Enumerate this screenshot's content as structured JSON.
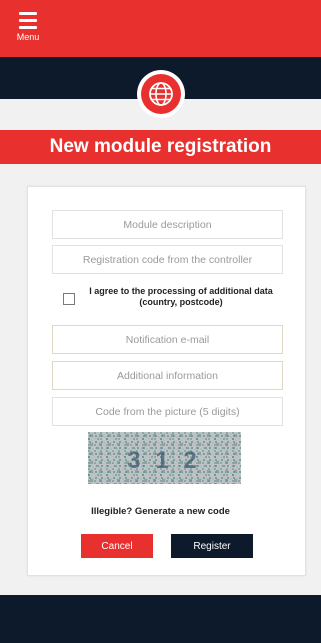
{
  "menu": {
    "label": "Menu"
  },
  "page": {
    "title": "New module registration"
  },
  "form": {
    "module_description": {
      "placeholder": "Module description"
    },
    "registration_code": {
      "placeholder": "Registration code from the controller"
    },
    "consent": {
      "label": "I agree to the processing of additional data (country, postcode)",
      "checked": false
    },
    "notification_email": {
      "placeholder": "Notification e-mail"
    },
    "additional_info": {
      "placeholder": "Additional information"
    },
    "captcha_code": {
      "placeholder": "Code from the picture (5 digits)"
    },
    "captcha_image": {
      "text": "3 1 2"
    },
    "regenerate_link": "Illegible? Generate a new code",
    "cancel_button": "Cancel",
    "register_button": "Register"
  },
  "colors": {
    "brand_red": "#e8302f",
    "navy": "#0d1a2b"
  },
  "icons": {
    "menu": "hamburger-icon",
    "logo": "globe-icon"
  }
}
